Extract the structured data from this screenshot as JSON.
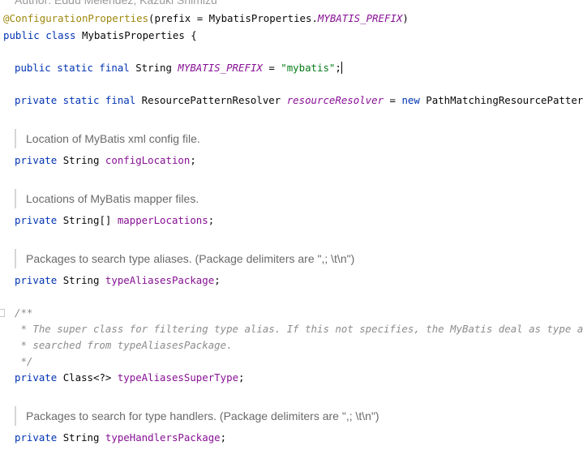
{
  "partial_header": "Author: Eddú Meléndez, Kazuki Shimizu",
  "code": {
    "annotation": "@ConfigurationProperties",
    "annotation_args_open": "(prefix = MybatisProperties.",
    "annotation_const": "MYBATIS_PREFIX",
    "annotation_args_close": ")",
    "class_decl_kw": "public class ",
    "class_decl_name": "MybatisProperties {",
    "prefix_line": {
      "modifiers": "public static final ",
      "type": "String ",
      "name": "MYBATIS_PREFIX",
      "eq": " = ",
      "value": "\"mybatis\"",
      "end": ";"
    },
    "resolver_line": {
      "modifiers": "private static final ",
      "type": "ResourcePatternResolver ",
      "name": "resourceResolver",
      "eq": " = ",
      "new_kw": "new ",
      "ctor": "PathMatchingResourcePatternResolver();"
    },
    "doc_config": "Location of MyBatis xml config file.",
    "config_line": {
      "modifiers": "private ",
      "type": "String ",
      "name": "configLocation",
      "end": ";"
    },
    "doc_mapper": "Locations of MyBatis mapper files.",
    "mapper_line": {
      "modifiers": "private ",
      "type": "String[] ",
      "name": "mapperLocations",
      "end": ";"
    },
    "doc_aliases": "Packages to search type aliases. (Package delimiters are \",; \\t\\n\")",
    "aliases_line": {
      "modifiers": "private ",
      "type": "String ",
      "name": "typeAliasesPackage",
      "end": ";"
    },
    "block_comment": {
      "open": "/**",
      "line1": " * The super class for filtering type alias. If this not specifies, the MyBatis deal as type alias all classes that",
      "line2": " * searched from typeAliasesPackage.",
      "close": " */"
    },
    "supertype_line": {
      "modifiers": "private ",
      "type": "Class<?> ",
      "name": "typeAliasesSuperType",
      "end": ";"
    },
    "doc_handlers": "Packages to search for type handlers. (Package delimiters are \",; \\t\\n\")",
    "handlers_line": {
      "modifiers": "private ",
      "type": "String ",
      "name": "typeHandlersPackage",
      "end": ";"
    }
  },
  "colors": {
    "keyword": "#0033b3",
    "annotation": "#9e880d",
    "field": "#871094",
    "string": "#067d17",
    "comment": "#8c8c8c",
    "doc_text": "#6a6a6a"
  }
}
